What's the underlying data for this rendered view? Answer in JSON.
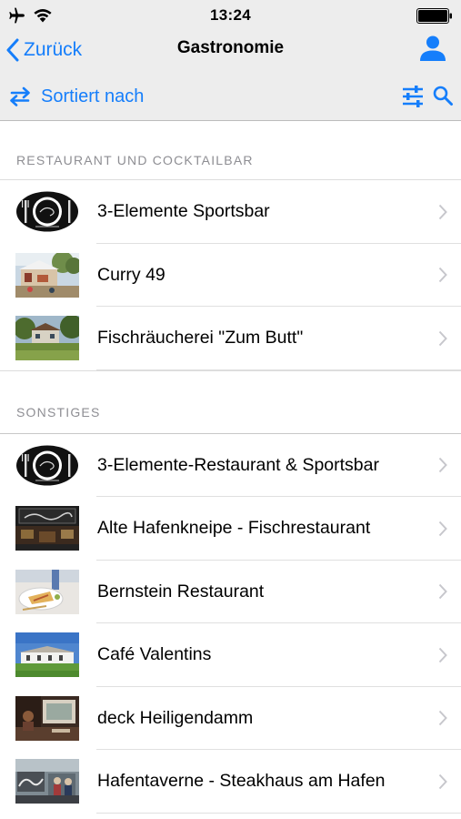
{
  "status_bar": {
    "time": "13:24"
  },
  "nav": {
    "back_label": "Zurück",
    "title": "Gastronomie"
  },
  "toolbar": {
    "sort_label": "Sortiert nach"
  },
  "colors": {
    "accent": "#157efb",
    "bar_background": "#ededed",
    "section_text": "#8e8e93"
  },
  "sections": [
    {
      "header": "RESTAURANT UND COCKTAILBAR",
      "items": [
        {
          "label": "3-Elemente Sportsbar",
          "thumb": "logo-3-elemente"
        },
        {
          "label": "Curry 49",
          "thumb": "photo-curry-49"
        },
        {
          "label": "Fischräucherei \"Zum Butt\"",
          "thumb": "photo-zum-butt"
        }
      ]
    },
    {
      "header": "SONSTIGES",
      "items": [
        {
          "label": "3-Elemente-Restaurant & Sportsbar",
          "thumb": "logo-3-elemente"
        },
        {
          "label": "Alte Hafenkneipe - Fischrestaurant",
          "thumb": "photo-hafenkneipe"
        },
        {
          "label": "Bernstein Restaurant",
          "thumb": "photo-bernstein"
        },
        {
          "label": "Café Valentins",
          "thumb": "photo-valentins"
        },
        {
          "label": "deck Heiligendamm",
          "thumb": "photo-deck"
        },
        {
          "label": "Hafentaverne - Steakhaus am Hafen",
          "thumb": "photo-hafentaverne"
        }
      ]
    }
  ]
}
